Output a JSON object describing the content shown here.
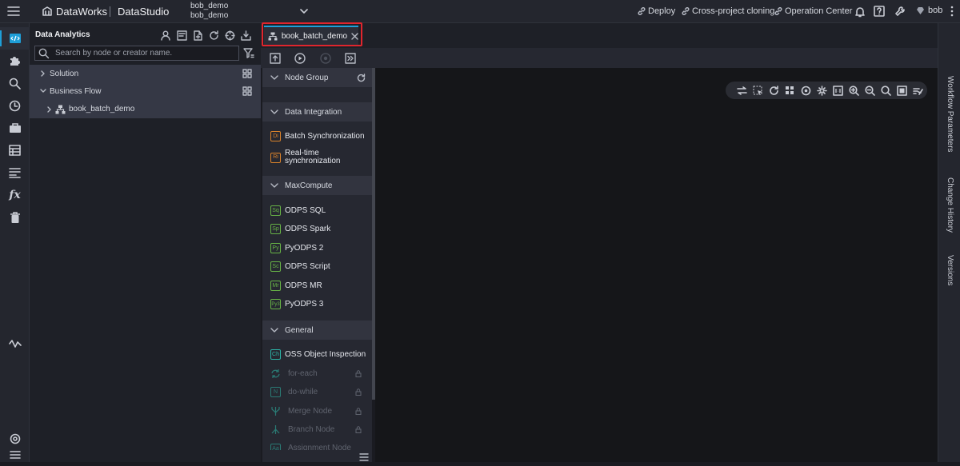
{
  "brand": {
    "name": "DataWorks",
    "module": "DataStudio"
  },
  "workspace": {
    "line1": "bob_demo",
    "line2": "bob_demo"
  },
  "top_actions": {
    "deploy": "Deploy",
    "cross_project": "Cross-project cloning",
    "operation_center": "Operation Center"
  },
  "user": {
    "name": "bob"
  },
  "tree_panel": {
    "title": "Data Analytics",
    "search_placeholder": "Search by node or creator name.",
    "items": [
      {
        "label": "Solution"
      },
      {
        "label": "Business Flow"
      },
      {
        "label": "book_batch_demo"
      }
    ]
  },
  "editor_tab": {
    "label": "book_batch_demo"
  },
  "palette": {
    "sections": {
      "node_group": "Node Group",
      "data_integration": "Data Integration",
      "maxcompute": "MaxCompute",
      "general": "General"
    },
    "data_integration_items": [
      {
        "tag": "Di",
        "label": "Batch Synchronization"
      },
      {
        "tag": "Ri",
        "label": "Real-time synchronization"
      }
    ],
    "maxcompute_items": [
      {
        "tag": "Sq",
        "label": "ODPS SQL"
      },
      {
        "tag": "Sp",
        "label": "ODPS Spark"
      },
      {
        "tag": "Py",
        "label": "PyODPS 2"
      },
      {
        "tag": "Sc",
        "label": "ODPS Script"
      },
      {
        "tag": "Mr",
        "label": "ODPS MR"
      },
      {
        "tag": "Py3",
        "label": "PyODPS 3"
      }
    ],
    "general_items": [
      {
        "tag": "Ch",
        "label": "OSS Object Inspection"
      },
      {
        "tag": "",
        "label": "for-each"
      },
      {
        "tag": "N",
        "label": "do-while"
      },
      {
        "tag": "",
        "label": "Merge Node"
      },
      {
        "tag": "",
        "label": "Branch Node"
      },
      {
        "tag": "Aa",
        "label": "Assignment Node"
      }
    ]
  },
  "right_panel": {
    "workflow_parameters": "Workflow Parameters",
    "change_history": "Change History",
    "versions": "Versions"
  },
  "colors": {
    "accent": "#1e9fd8",
    "highlight": "#e0252d",
    "di_tag": "#d9822b",
    "mc_tag": "#67b346",
    "general_tag": "#2cb3a6"
  }
}
